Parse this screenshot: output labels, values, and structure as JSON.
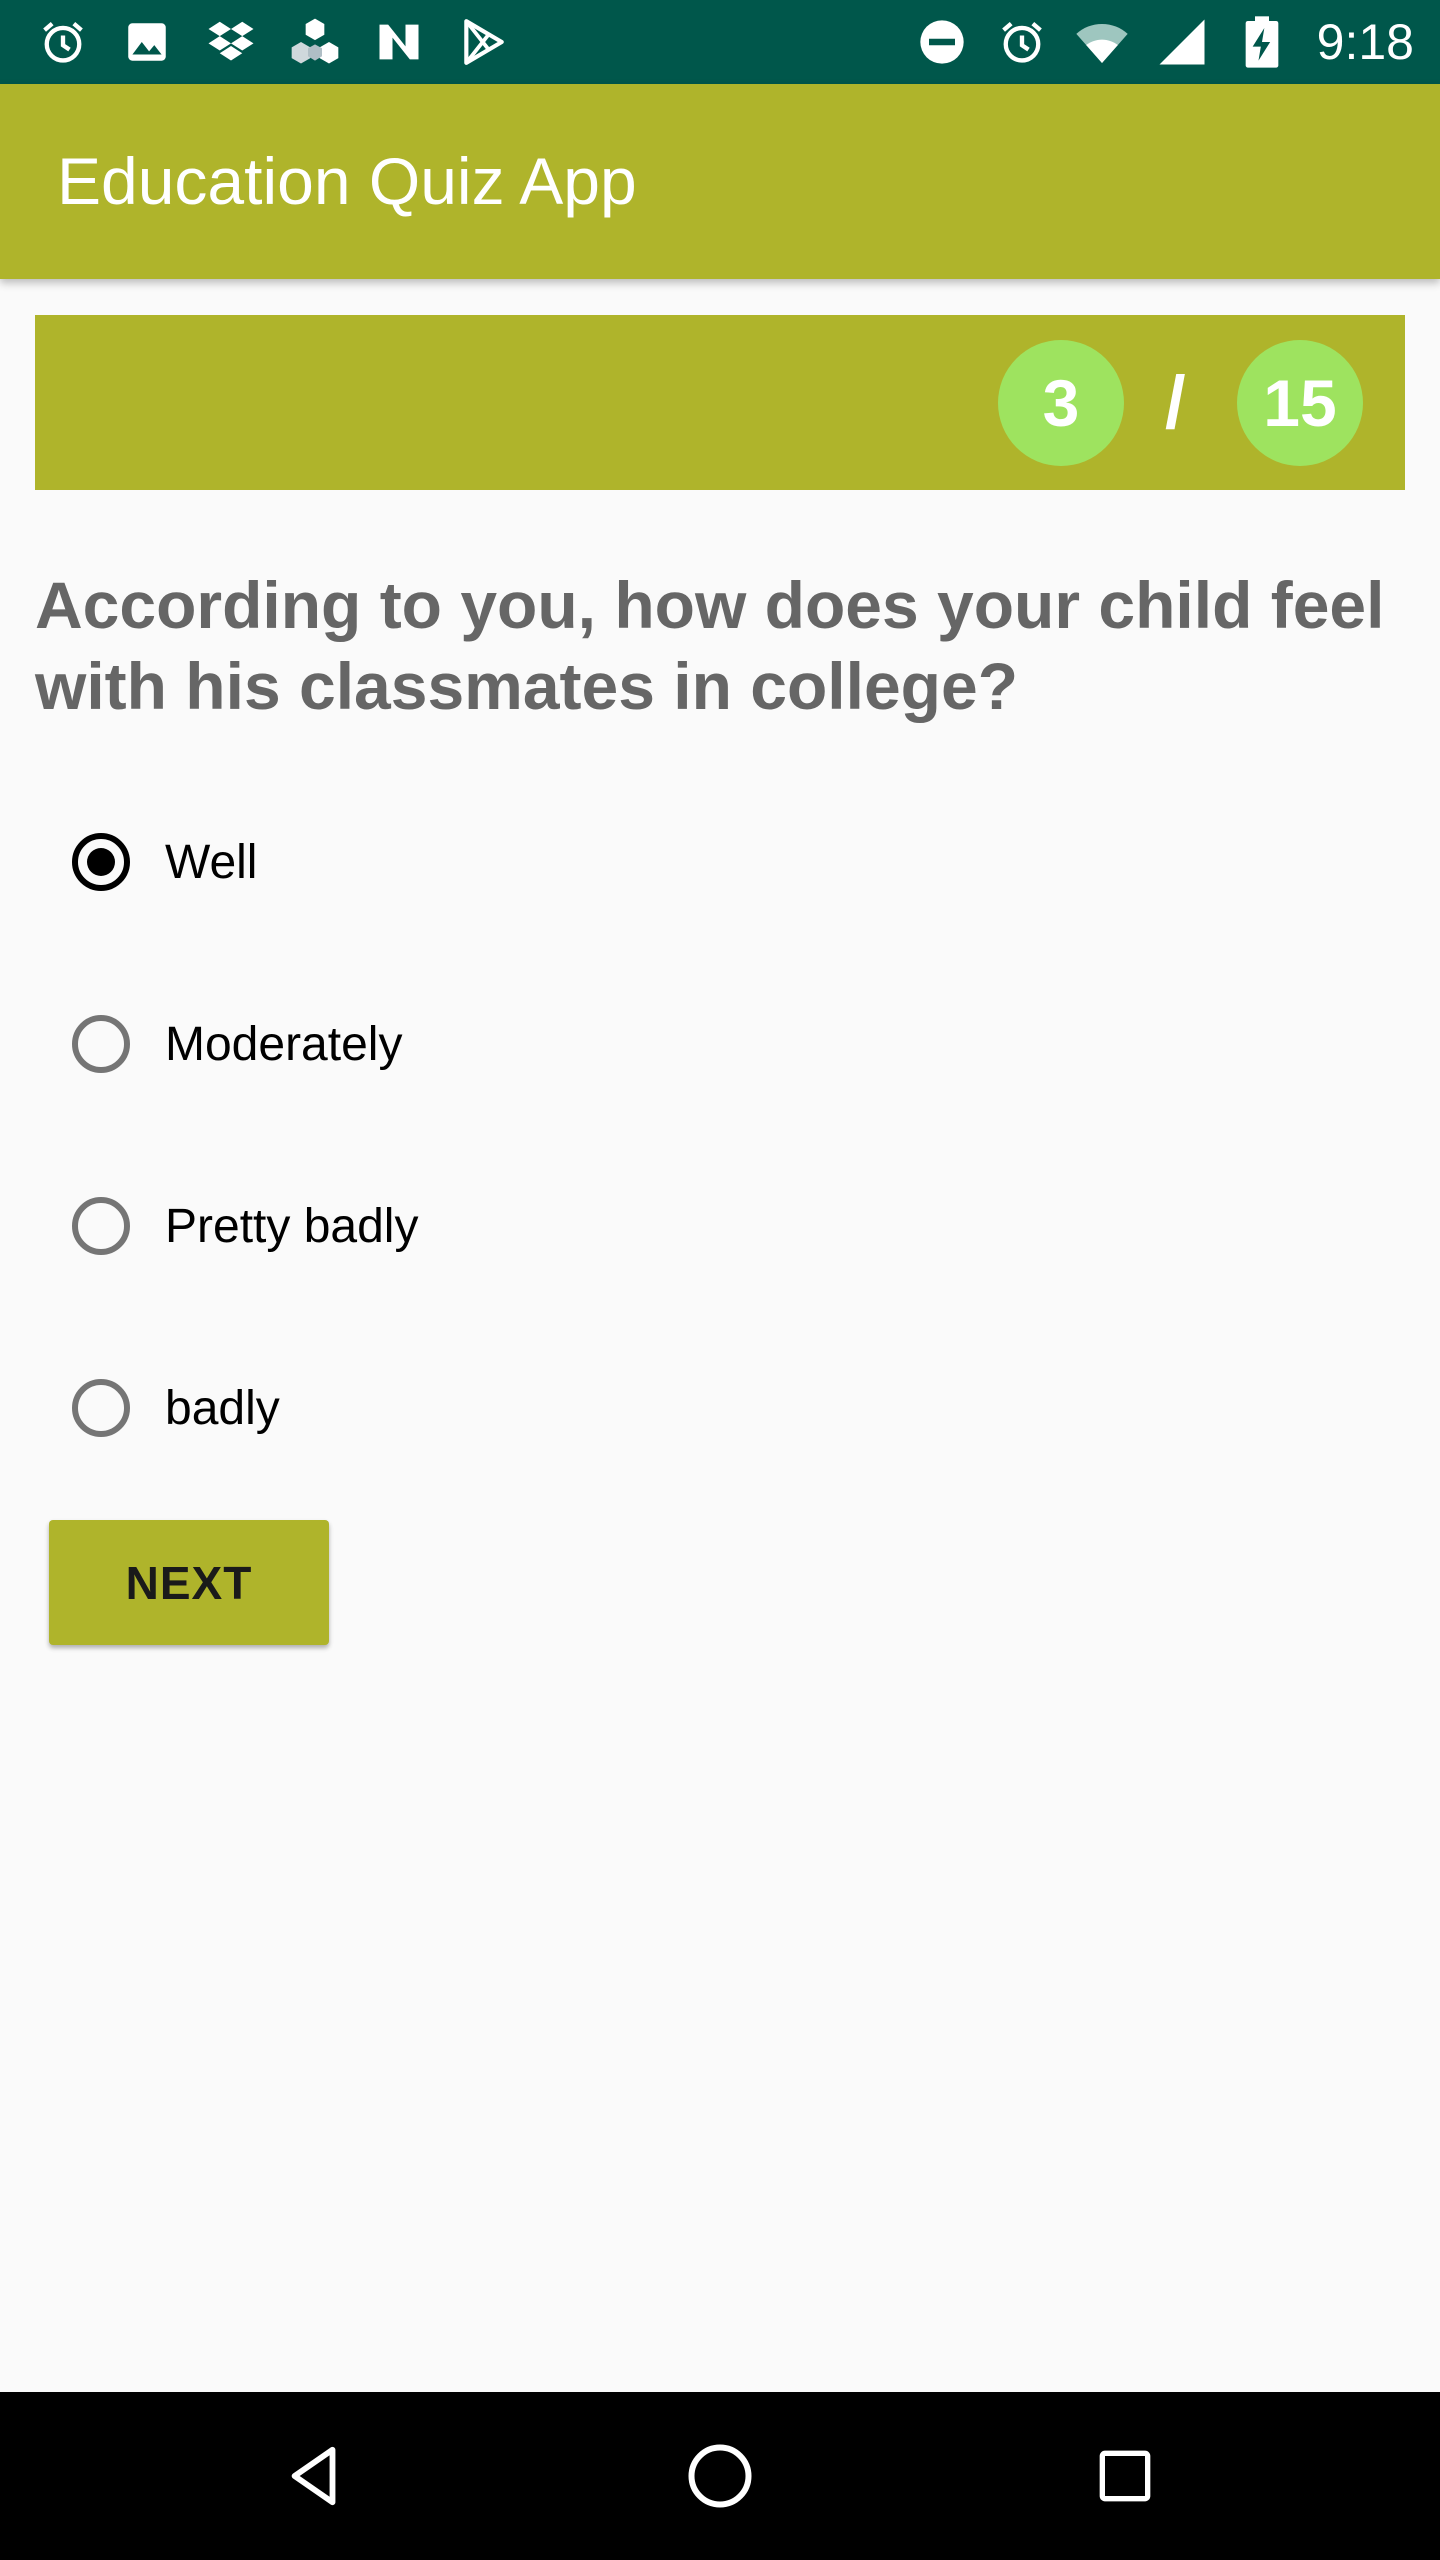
{
  "status_bar": {
    "time": "9:18",
    "left_icons": [
      "alarm-icon",
      "image-icon",
      "dropbox-icon",
      "cube-icon",
      "n-app-icon",
      "play-store-icon"
    ],
    "right_icons": [
      "do-not-disturb-icon",
      "alarm-icon",
      "wifi-icon",
      "signal-icon",
      "battery-charging-icon"
    ]
  },
  "app_bar": {
    "title": "Education Quiz App",
    "color": "#afb42b"
  },
  "progress": {
    "current": "3",
    "separator": "/",
    "total": "15",
    "circle_color": "#9ee35f"
  },
  "question": {
    "text": "According to you, how does your child feel with his classmates in college?"
  },
  "options": [
    {
      "label": "Well",
      "selected": true
    },
    {
      "label": "Moderately",
      "selected": false
    },
    {
      "label": "Pretty badly",
      "selected": false
    },
    {
      "label": "badly",
      "selected": false
    }
  ],
  "next_button": {
    "label": "NEXT"
  },
  "nav_bar": {
    "icons": [
      "back-icon",
      "home-icon",
      "recent-apps-icon"
    ]
  }
}
